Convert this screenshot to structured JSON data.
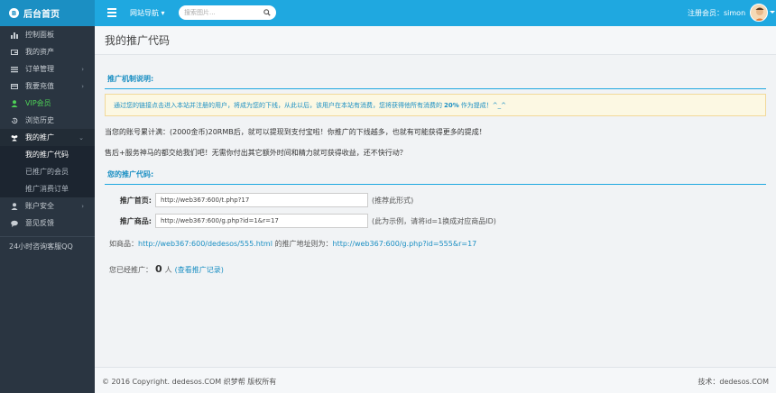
{
  "brand": {
    "logo": "B",
    "title": "后台首页"
  },
  "topbar": {
    "nav_label": "网站导航",
    "search_placeholder": "搜索图片...",
    "user_label": "注册会员：simon"
  },
  "sidebar": {
    "items": [
      {
        "label": "控制面板",
        "icon": "bar-chart-icon"
      },
      {
        "label": "我的资产",
        "icon": "wallet-icon"
      },
      {
        "label": "订单管理",
        "icon": "list-icon"
      },
      {
        "label": "我要充值",
        "icon": "card-icon"
      },
      {
        "label": "VIP会员",
        "icon": "user-icon"
      },
      {
        "label": "浏览历史",
        "icon": "history-icon"
      },
      {
        "label": "我的推广",
        "icon": "group-icon"
      }
    ],
    "sub_items": [
      {
        "label": "我的推广代码"
      },
      {
        "label": "已推广的会员"
      },
      {
        "label": "推广消费订单"
      }
    ],
    "items_after": [
      {
        "label": "账户安全",
        "icon": "user-icon"
      },
      {
        "label": "意见反馈",
        "icon": "comment-icon"
      }
    ],
    "qq_label": "24小时咨询客服QQ"
  },
  "page": {
    "title": "我的推广代码",
    "section1": "推广机制说明:",
    "notice_pre": "通过您的链接点击进入本站并注册的用户，将成为您的下线，从此以后，该用户在本站有消费，您将获得他所有消费的",
    "notice_pct": "20%",
    "notice_post": "作为提成！^_^",
    "line1": "当您的账号累计满：(2000金币)20RMB后，就可以提现到支付宝啦！你推广的下线越多，也就有可能获得更多的提成！",
    "line2": "售后+服务神马的都交给我们吧！无需你付出其它额外时间和精力就可获得收益，还不快行动？",
    "section2": "您的推广代码:",
    "home_label": "推广首页:",
    "home_value": "http://web367:600/t.php?17",
    "home_hint": "(推荐此形式)",
    "product_label": "推广商品:",
    "product_value": "http://web367:600/g.php?id=1&r=17",
    "product_hint": "(此为示例，请将id=1换成对应商品ID)",
    "example_pre": "如商品：",
    "example_link1": "http://web367:600/dedesos/555.html",
    "example_mid": "的推广地址则为：",
    "example_link2": "http://web367:600/g.php?id=555&r=17",
    "promoted_pre": "您已经推广：",
    "promoted_count": "0",
    "promoted_unit": "人",
    "promoted_link": "(查看推广记录)"
  },
  "footer": {
    "left": "© 2016 Copyright. dedesos.COM 织梦帮 版权所有",
    "right": "技术：dedesos.COM"
  },
  "colors": {
    "topbar": "#1fa8e0",
    "brand_bg": "#1b8fc3",
    "sidebar": "#2a3541",
    "accent_green": "#4ed157",
    "notice_bg": "#fcf8e3"
  }
}
